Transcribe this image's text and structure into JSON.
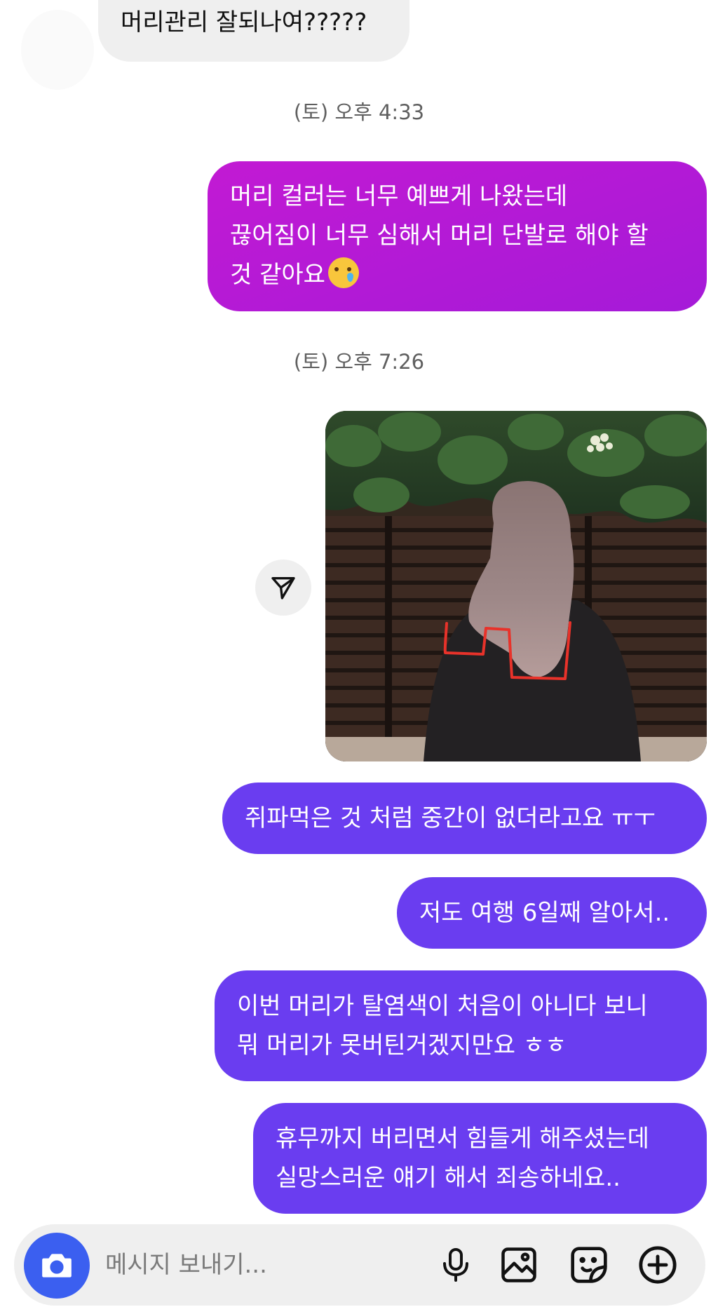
{
  "messages": {
    "received_1": "머리관리 잘되나여?????",
    "timestamp_1": "(토) 오후 4:33",
    "sent_1": {
      "line1": "머리 컬러는 너무 예쁘게 나왔는데",
      "line2": "끊어짐이 너무 심해서 머리 단발로 해야 할",
      "line3": "것 같아요"
    },
    "timestamp_2": "(토) 오후 7:26",
    "sent_2": "쥐파먹은 것 처럼 중간이 없더라고요 ㅠㅜ",
    "sent_3": "저도 여행 6일째 알아서..",
    "sent_4": {
      "line1": "이번 머리가 탈염색이 처음이 아니다 보니",
      "line2": "뭐 머리가 못버틴거겠지만요 ㅎㅎ"
    },
    "sent_5": {
      "line1": "휴무까지 버리면서 힘들게 해주셨는데",
      "line2": "실망스러운 얘기 해서 죄송하네요.."
    }
  },
  "composer": {
    "placeholder": "메시지 보내기...",
    "icons": [
      "camera-icon",
      "microphone-icon",
      "gallery-icon",
      "sticker-icon",
      "plus-icon"
    ]
  },
  "colors": {
    "received_bubble": "#efefef",
    "sent_magenta": "#b81ad6",
    "sent_purple": "#6a3df0",
    "camera_button": "#3b5ff0",
    "timestamp": "#5f5f5f"
  },
  "photo": {
    "annotation_color": "#e8322a"
  }
}
